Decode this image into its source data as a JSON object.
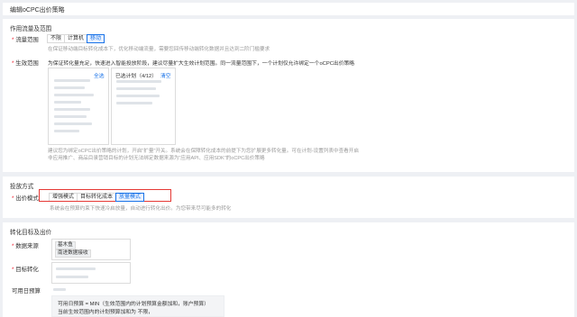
{
  "page_title": "编辑oCPC出价策略",
  "section1": {
    "title": "作用流量及范围",
    "traffic": {
      "label": "流量范围",
      "options": [
        "不限",
        "计算机",
        "移动"
      ],
      "selected": "移动",
      "hint": "在保证移动端目标转化成本下，优化移动端流量，需要您回传移动端转化数据并且达到二阶门槛要求"
    },
    "scope": {
      "label": "生效范围",
      "hint": "为保证转化量充足，快速进入智能投放阶段，建议尽量扩大生效计划范围。同一流量范围下，一个计划仅允许绑定一个oCPC出价策略",
      "left_link": "全选",
      "right_header": "已选计划（4/12）",
      "right_link": "清空",
      "note": "建议您为绑定oCPC出价策略的计划，开启“扩量”开关。系统会在保障转化成本的前提下为您扩展更多转化量。可在计划-设置列表中查看开启",
      "note2": "非应用推广、商品目录营销目标的计划无法绑定数据来源为“应用API、应用SDK”的oCPC出价策略"
    }
  },
  "section2": {
    "title": "投放方式",
    "bid_mode": {
      "label": "出价模式",
      "options": [
        "增强模式",
        "目标转化成本",
        "放量模式"
      ],
      "selected": "放量模式",
      "hint": "系统会在预算约束下快速冷启放量，自动进行转化出价。为您带来尽可能多的转化"
    }
  },
  "section3": {
    "title": "转化目标及出价",
    "source": {
      "label": "数据来源",
      "tags": [
        "基木鱼",
        "南进数据接收"
      ]
    },
    "goal": {
      "label": "目标转化"
    },
    "budget_label": "可用日预算",
    "budget_text1": "可用日预算 = MIN（生效范围内的计划预算金额加和，账户预算）",
    "budget_text2": "当前生效范围内的计划预算加和为 不限，"
  }
}
